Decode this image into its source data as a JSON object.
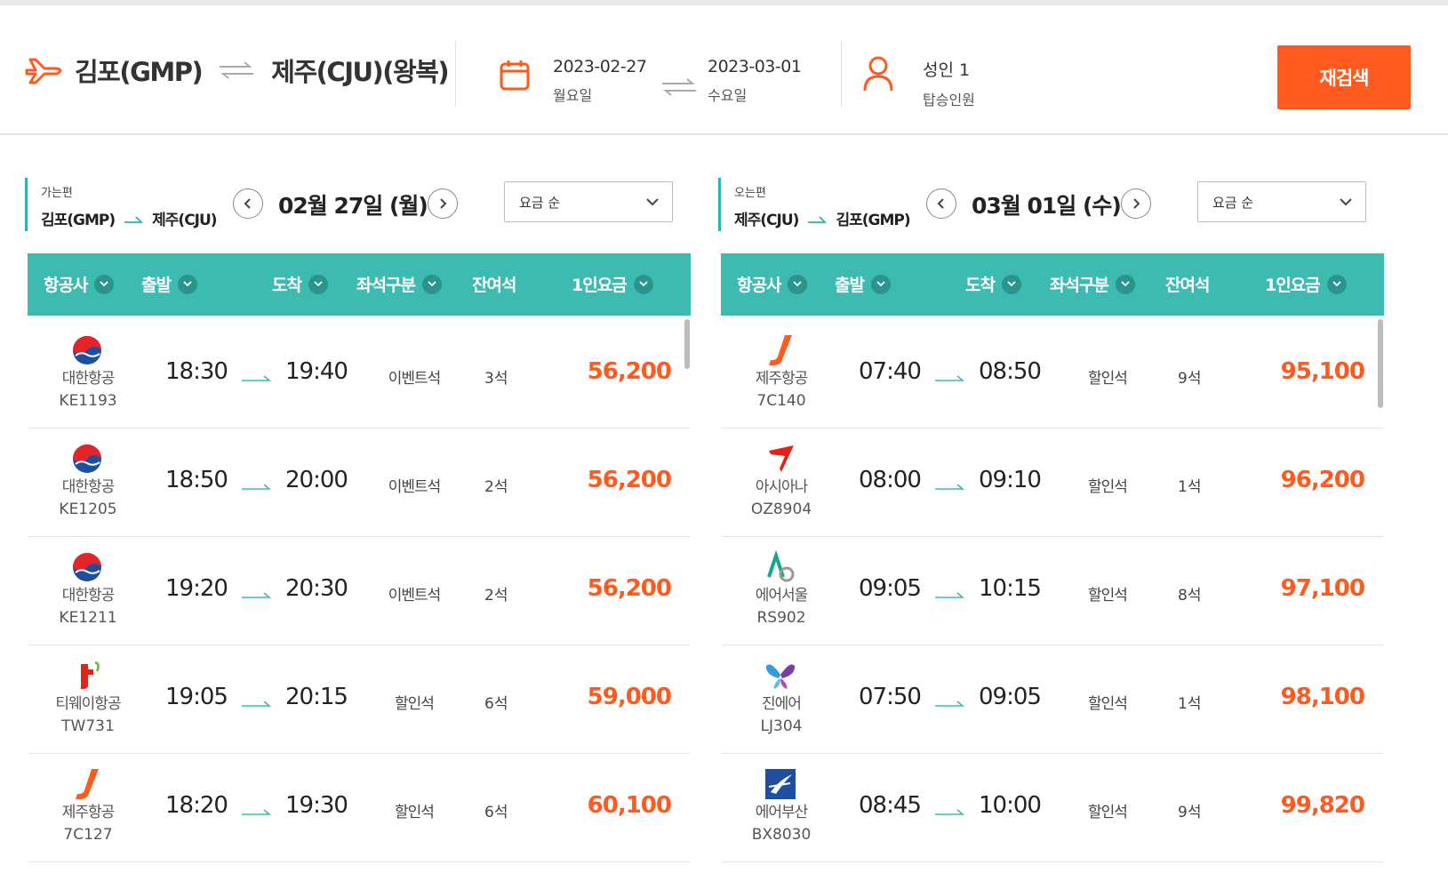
{
  "search": {
    "origin": "김포(GMP)",
    "destination": "제주(CJU)(왕복)",
    "depart_date": "2023-02-27",
    "depart_weekday": "월요일",
    "return_date": "2023-03-01",
    "return_weekday": "수요일",
    "passengers": "성인 1",
    "passengers_label": "탑승인원",
    "research_button": "재검색"
  },
  "colors": {
    "accent": "#ff5a1f",
    "header_teal": "#3dbbb1",
    "leg_border": "#2bb5ad"
  },
  "outbound": {
    "label": "가는편",
    "from": "김포(GMP)",
    "to": "제주(CJU)",
    "date_title": "02월 27일 (월)",
    "sort": "요금 순",
    "headers": {
      "airline": "항공사",
      "depart": "출발",
      "arrive": "도착",
      "seat": "좌석구분",
      "remain": "잔여석",
      "fare": "1인요금"
    },
    "flights": [
      {
        "logo": "korean-air-icon",
        "airline": "대한항공",
        "flight_no": "KE1193",
        "depart": "18:30",
        "arrive": "19:40",
        "seat": "이벤트석",
        "remain": "3석",
        "fare": "56,200"
      },
      {
        "logo": "korean-air-icon",
        "airline": "대한항공",
        "flight_no": "KE1205",
        "depart": "18:50",
        "arrive": "20:00",
        "seat": "이벤트석",
        "remain": "2석",
        "fare": "56,200"
      },
      {
        "logo": "korean-air-icon",
        "airline": "대한항공",
        "flight_no": "KE1211",
        "depart": "19:20",
        "arrive": "20:30",
        "seat": "이벤트석",
        "remain": "2석",
        "fare": "56,200"
      },
      {
        "logo": "tway-icon",
        "airline": "티웨이항공",
        "flight_no": "TW731",
        "depart": "19:05",
        "arrive": "20:15",
        "seat": "할인석",
        "remain": "6석",
        "fare": "59,000"
      },
      {
        "logo": "jeju-air-icon",
        "airline": "제주항공",
        "flight_no": "7C127",
        "depart": "18:20",
        "arrive": "19:30",
        "seat": "할인석",
        "remain": "6석",
        "fare": "60,100"
      }
    ]
  },
  "inbound": {
    "label": "오는편",
    "from": "제주(CJU)",
    "to": "김포(GMP)",
    "date_title": "03월 01일 (수)",
    "sort": "요금 순",
    "headers": {
      "airline": "항공사",
      "depart": "출발",
      "arrive": "도착",
      "seat": "좌석구분",
      "remain": "잔여석",
      "fare": "1인요금"
    },
    "flights": [
      {
        "logo": "jeju-air-icon",
        "airline": "제주항공",
        "flight_no": "7C140",
        "depart": "07:40",
        "arrive": "08:50",
        "seat": "할인석",
        "remain": "9석",
        "fare": "95,100"
      },
      {
        "logo": "asiana-icon",
        "airline": "아시아나",
        "flight_no": "OZ8904",
        "depart": "08:00",
        "arrive": "09:10",
        "seat": "할인석",
        "remain": "1석",
        "fare": "96,200"
      },
      {
        "logo": "air-seoul-icon",
        "airline": "에어서울",
        "flight_no": "RS902",
        "depart": "09:05",
        "arrive": "10:15",
        "seat": "할인석",
        "remain": "8석",
        "fare": "97,100"
      },
      {
        "logo": "jin-air-icon",
        "airline": "진에어",
        "flight_no": "LJ304",
        "depart": "07:50",
        "arrive": "09:05",
        "seat": "할인석",
        "remain": "1석",
        "fare": "98,100"
      },
      {
        "logo": "air-busan-icon",
        "airline": "에어부산",
        "flight_no": "BX8030",
        "depart": "08:45",
        "arrive": "10:00",
        "seat": "할인석",
        "remain": "9석",
        "fare": "99,820"
      }
    ]
  }
}
